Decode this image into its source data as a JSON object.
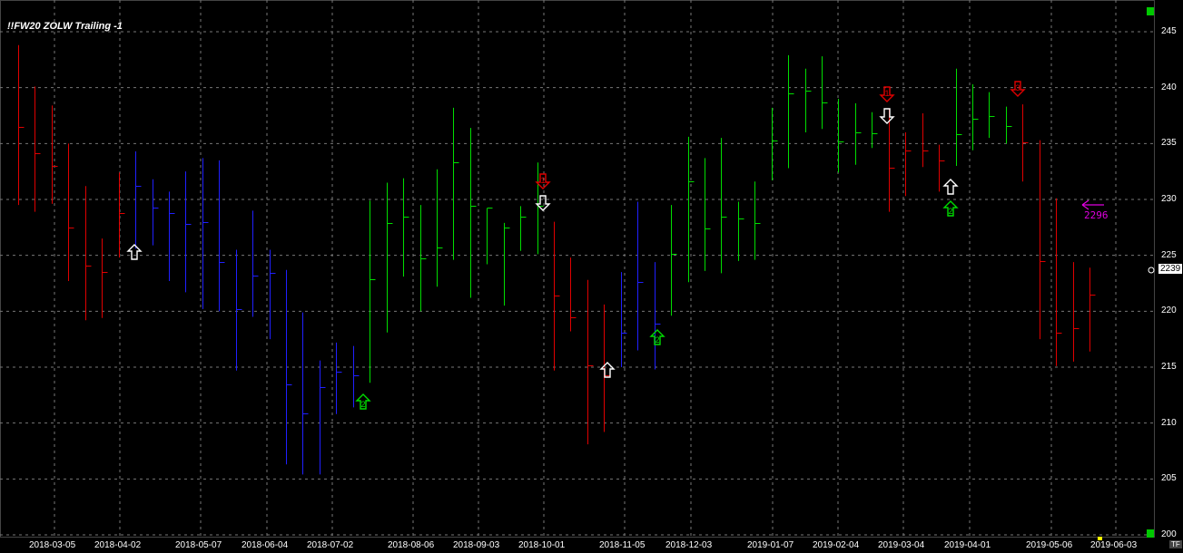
{
  "chart_data": {
    "type": "ohlc-bar",
    "title": "!!FW20 ZOLW Trailing -1",
    "last_price": "2239",
    "annotation": "2296",
    "ylim": [
      200,
      246
    ],
    "yticks": [
      "245",
      "240",
      "235",
      "230",
      "225",
      "220",
      "215",
      "210",
      "205",
      "200"
    ],
    "xticks": [
      "2018-03-05",
      "2018-04-02",
      "2018-05-07",
      "2018-06-04",
      "2018-07-02",
      "2018-08-06",
      "2018-09-03",
      "2018-10-01",
      "2018-11-05",
      "2018-12-03",
      "2019-01-07",
      "2019-02-04",
      "2019-03-04",
      "2019-04-01",
      "2019-05-06",
      "2019-06-03"
    ],
    "timeframe_label": "TF",
    "colors": {
      "up": "#00dd00",
      "down": "#e00000",
      "neutral": "#2020ff",
      "grid": "#777777",
      "marker": "#ffffff",
      "annotation": "#e000e0"
    },
    "bars": [
      {
        "h": 243.8,
        "l": 229.5,
        "c": 236.5,
        "col": "down"
      },
      {
        "h": 240.1,
        "l": 228.9,
        "c": 234.1,
        "col": "down"
      },
      {
        "h": 238.4,
        "l": 229.6,
        "c": 233.0,
        "col": "down"
      },
      {
        "h": 235.0,
        "l": 222.7,
        "c": 227.5,
        "col": "down"
      },
      {
        "h": 231.2,
        "l": 219.2,
        "c": 224.1,
        "col": "down"
      },
      {
        "h": 226.5,
        "l": 219.4,
        "c": 223.5,
        "col": "down"
      },
      {
        "h": 232.4,
        "l": 224.8,
        "c": 228.8,
        "col": "down"
      },
      {
        "h": 234.3,
        "l": 225.6,
        "c": 231.2,
        "col": "neutral"
      },
      {
        "h": 231.8,
        "l": 225.9,
        "c": 229.3,
        "col": "neutral"
      },
      {
        "h": 230.7,
        "l": 222.7,
        "c": 228.8,
        "col": "neutral"
      },
      {
        "h": 232.5,
        "l": 221.7,
        "c": 227.8,
        "col": "neutral"
      },
      {
        "h": 233.7,
        "l": 220.2,
        "c": 228.0,
        "col": "neutral"
      },
      {
        "h": 233.5,
        "l": 220.0,
        "c": 224.4,
        "col": "neutral"
      },
      {
        "h": 225.5,
        "l": 214.7,
        "c": 220.2,
        "col": "neutral"
      },
      {
        "h": 229.0,
        "l": 219.5,
        "c": 223.2,
        "col": "neutral"
      },
      {
        "h": 225.5,
        "l": 217.5,
        "c": 223.4,
        "col": "neutral"
      },
      {
        "h": 223.7,
        "l": 206.3,
        "c": 213.5,
        "col": "neutral"
      },
      {
        "h": 219.9,
        "l": 205.4,
        "c": 210.9,
        "col": "neutral"
      },
      {
        "h": 215.6,
        "l": 205.4,
        "c": 213.2,
        "col": "neutral"
      },
      {
        "h": 217.2,
        "l": 210.8,
        "c": 214.6,
        "col": "neutral"
      },
      {
        "h": 216.9,
        "l": 211.4,
        "c": 214.3,
        "col": "neutral"
      },
      {
        "h": 229.9,
        "l": 213.6,
        "c": 222.9,
        "col": "up"
      },
      {
        "h": 231.5,
        "l": 218.1,
        "c": 227.9,
        "col": "up"
      },
      {
        "h": 231.9,
        "l": 223.1,
        "c": 228.5,
        "col": "up"
      },
      {
        "h": 229.5,
        "l": 220.0,
        "c": 224.7,
        "col": "up"
      },
      {
        "h": 232.7,
        "l": 222.2,
        "c": 225.7,
        "col": "up"
      },
      {
        "h": 238.2,
        "l": 224.6,
        "c": 233.3,
        "col": "up"
      },
      {
        "h": 236.4,
        "l": 221.2,
        "c": 229.4,
        "col": "up"
      },
      {
        "h": 229.2,
        "l": 224.2,
        "c": 229.3,
        "col": "up"
      },
      {
        "h": 227.9,
        "l": 220.5,
        "c": 227.5,
        "col": "up"
      },
      {
        "h": 229.4,
        "l": 225.4,
        "c": 228.5,
        "col": "up"
      },
      {
        "h": 233.3,
        "l": 225.1,
        "c": 229.4,
        "col": "up"
      },
      {
        "h": 228.0,
        "l": 214.7,
        "c": 221.4,
        "col": "down"
      },
      {
        "h": 224.8,
        "l": 218.2,
        "c": 219.5,
        "col": "down"
      },
      {
        "h": 222.8,
        "l": 208.1,
        "c": 215.2,
        "col": "down"
      },
      {
        "h": 220.6,
        "l": 209.2,
        "c": 214.3,
        "col": "down"
      },
      {
        "h": 223.5,
        "l": 215.0,
        "c": 218.1,
        "col": "neutral"
      },
      {
        "h": 229.8,
        "l": 216.5,
        "c": 222.6,
        "col": "neutral"
      },
      {
        "h": 224.4,
        "l": 214.8,
        "c": 218.9,
        "col": "neutral"
      },
      {
        "h": 229.5,
        "l": 219.6,
        "c": 225.1,
        "col": "up"
      },
      {
        "h": 235.6,
        "l": 222.6,
        "c": 231.6,
        "col": "up"
      },
      {
        "h": 233.7,
        "l": 223.6,
        "c": 227.4,
        "col": "up"
      },
      {
        "h": 235.5,
        "l": 223.4,
        "c": 228.5,
        "col": "up"
      },
      {
        "h": 229.8,
        "l": 224.5,
        "c": 228.3,
        "col": "up"
      },
      {
        "h": 231.6,
        "l": 224.6,
        "c": 227.9,
        "col": "up"
      },
      {
        "h": 238.2,
        "l": 231.7,
        "c": 235.3,
        "col": "up"
      },
      {
        "h": 242.9,
        "l": 232.8,
        "c": 239.5,
        "col": "up"
      },
      {
        "h": 241.7,
        "l": 236.0,
        "c": 239.7,
        "col": "up"
      },
      {
        "h": 242.8,
        "l": 236.3,
        "c": 238.7,
        "col": "up"
      },
      {
        "h": 239.0,
        "l": 232.4,
        "c": 235.2,
        "col": "up"
      },
      {
        "h": 238.6,
        "l": 233.1,
        "c": 236.0,
        "col": "up"
      },
      {
        "h": 237.8,
        "l": 234.6,
        "c": 235.9,
        "col": "up"
      },
      {
        "h": 238.1,
        "l": 228.9,
        "c": 232.8,
        "col": "down"
      },
      {
        "h": 236.0,
        "l": 230.3,
        "c": 234.4,
        "col": "down"
      },
      {
        "h": 237.7,
        "l": 232.9,
        "c": 234.4,
        "col": "down"
      },
      {
        "h": 234.9,
        "l": 230.7,
        "c": 233.5,
        "col": "down"
      },
      {
        "h": 241.7,
        "l": 233.0,
        "c": 235.8,
        "col": "up"
      },
      {
        "h": 240.3,
        "l": 234.4,
        "c": 237.2,
        "col": "up"
      },
      {
        "h": 239.6,
        "l": 235.5,
        "c": 237.5,
        "col": "up"
      },
      {
        "h": 238.3,
        "l": 235.0,
        "c": 236.6,
        "col": "up"
      },
      {
        "h": 238.5,
        "l": 231.6,
        "c": 235.1,
        "col": "down"
      },
      {
        "h": 235.3,
        "l": 217.5,
        "c": 224.5,
        "col": "down"
      },
      {
        "h": 230.1,
        "l": 215.1,
        "c": 218.1,
        "col": "down"
      },
      {
        "h": 224.4,
        "l": 215.5,
        "c": 218.5,
        "col": "down"
      },
      {
        "h": 223.9,
        "l": 216.4,
        "c": 221.5,
        "col": "down"
      }
    ],
    "signals": [
      {
        "bar": 7,
        "type": "buy-arrow",
        "text": ""
      },
      {
        "bar": 21,
        "type": "buy-arrow-green",
        "text": "2"
      },
      {
        "bar": 32,
        "type": "sell-arrow-red",
        "text": "1"
      },
      {
        "bar": 32,
        "type": "buy-arrow-white-down",
        "text": ""
      },
      {
        "bar": 37,
        "type": "buy-arrow",
        "text": ""
      },
      {
        "bar": 39,
        "type": "buy-arrow-green",
        "text": "2"
      },
      {
        "bar": 54,
        "type": "sell-arrow-red",
        "text": "1"
      },
      {
        "bar": 54,
        "type": "buy-arrow-white-down",
        "text": ""
      },
      {
        "bar": 58,
        "type": "buy-arrow",
        "text": ""
      },
      {
        "bar": 58,
        "type": "buy-arrow-green",
        "text": "2"
      },
      {
        "bar": 62,
        "type": "sell-arrow-red",
        "text": "3"
      }
    ]
  }
}
